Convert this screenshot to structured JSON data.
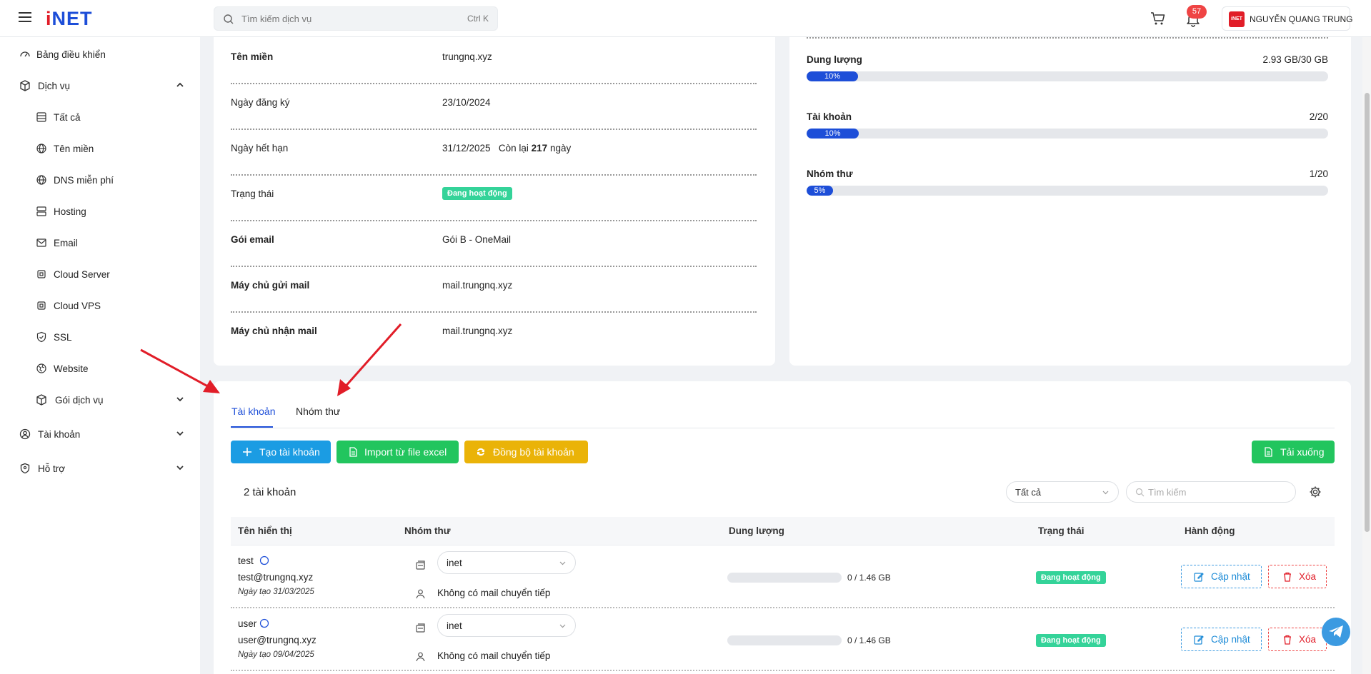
{
  "header": {
    "logo_prefix": "i",
    "logo_text": "NET",
    "search_placeholder": "Tìm kiếm dịch vụ",
    "search_shortcut": "Ctrl K",
    "notifications_count": "57",
    "avatar_text": "iNET",
    "user_name": "NGUYỄN QUANG TRUNG"
  },
  "sidebar": {
    "items": [
      {
        "label": "Bảng điều khiển",
        "icon": "dashboard-icon"
      },
      {
        "label": "Dịch vụ",
        "icon": "box-icon"
      },
      {
        "label": "Tất cả",
        "icon": "list-icon"
      },
      {
        "label": "Tên miền",
        "icon": "globe-icon"
      },
      {
        "label": "DNS miễn phí",
        "icon": "globe-icon"
      },
      {
        "label": "Hosting",
        "icon": "server-icon"
      },
      {
        "label": "Email",
        "icon": "mail-icon"
      },
      {
        "label": "Cloud Server",
        "icon": "chip-icon"
      },
      {
        "label": "Cloud VPS",
        "icon": "chip-icon"
      },
      {
        "label": "SSL",
        "icon": "shield-icon"
      },
      {
        "label": "Website",
        "icon": "web-icon"
      },
      {
        "label": "Gói dịch vụ",
        "icon": "box-icon"
      },
      {
        "label": "Tài khoản",
        "icon": "user-circle-icon"
      },
      {
        "label": "Hỗ trợ",
        "icon": "help-icon"
      }
    ]
  },
  "info": {
    "rows": [
      {
        "key": "Tên miền",
        "value": "trungnq.xyz"
      },
      {
        "key": "Ngày đăng ký",
        "value": "23/10/2024"
      },
      {
        "key": "Ngày hết hạn",
        "value": "31/12/2025",
        "remain_prefix": "Còn lại",
        "remain_days": "217",
        "remain_suffix": "ngày"
      },
      {
        "key": "Trạng thái",
        "value": "Đang hoạt động"
      },
      {
        "key": "Gói email",
        "value": "Gói B - OneMail"
      },
      {
        "key": "Máy chủ gửi mail",
        "value": "mail.trungnq.xyz"
      },
      {
        "key": "Máy chủ nhận mail",
        "value": "mail.trungnq.xyz"
      }
    ]
  },
  "usage": [
    {
      "label": "Dung lượng",
      "value": "2.93 GB/30 GB",
      "percent": 10,
      "percent_label": "10%"
    },
    {
      "label": "Tài khoản",
      "value": "2/20",
      "percent": 10,
      "percent_label": "10%"
    },
    {
      "label": "Nhóm thư",
      "value": "1/20",
      "percent": 5,
      "percent_label": "5%"
    }
  ],
  "tabs": [
    {
      "label": "Tài khoản",
      "active": true
    },
    {
      "label": "Nhóm thư",
      "active": false
    }
  ],
  "actions": {
    "create": "Tạo tài khoản",
    "import": "Import từ file excel",
    "sync": "Đồng bộ tài khoản",
    "download": "Tải xuống"
  },
  "list": {
    "count_label": "2 tài khoản",
    "filter_value": "Tất cả",
    "search_placeholder": "Tìm kiếm",
    "columns": [
      "Tên hiển thị",
      "Nhóm thư",
      "Dung lượng",
      "Trạng thái",
      "Hành động"
    ],
    "rows": [
      {
        "name": "test",
        "email": "test@trungnq.xyz",
        "created": "Ngày tạo 31/03/2025",
        "group": "inet",
        "forward": "Không có mail chuyển tiếp",
        "usage": "0 / 1.46 GB",
        "usage_percent": 0,
        "status": "Đang hoạt động",
        "update": "Cập nhật",
        "delete": "Xóa"
      },
      {
        "name": "user",
        "email": "user@trungnq.xyz",
        "created": "Ngày tạo 09/04/2025",
        "group": "inet",
        "forward": "Không có mail chuyển tiếp",
        "usage": "0 / 1.46 GB",
        "usage_percent": 0,
        "status": "Đang hoạt động",
        "update": "Cập nhật",
        "delete": "Xóa"
      }
    ]
  },
  "colors": {
    "primary": "#1d4ed8",
    "create_btn": "#1b9ce3",
    "import_btn": "#22c55e",
    "sync_btn": "#eab308",
    "download_btn": "#22c55e",
    "status_green": "#34d399",
    "danger": "#ef4444",
    "annotation_arrow": "#e11d28"
  }
}
